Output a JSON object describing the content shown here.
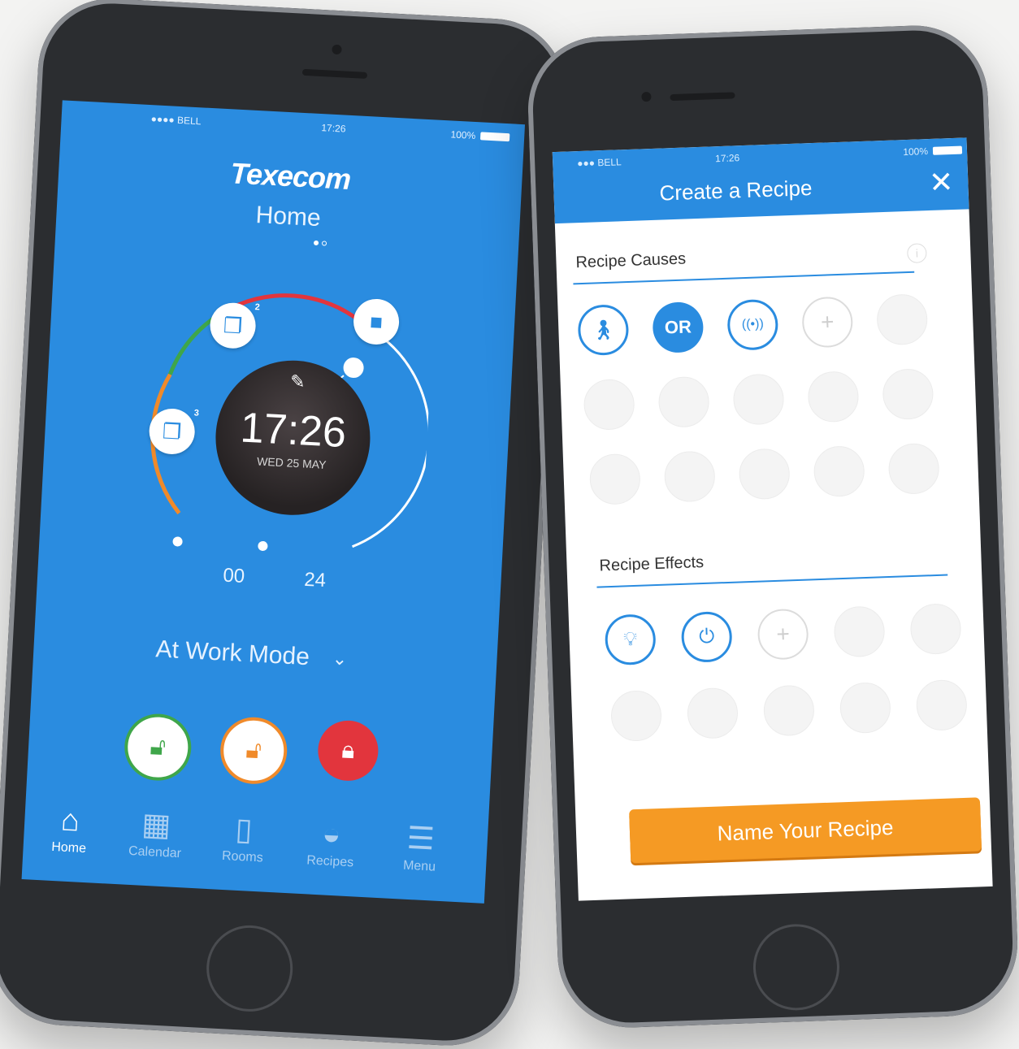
{
  "left_phone": {
    "status": {
      "carrier": "●●●● BELL",
      "time": "17:26",
      "battery": "100%"
    },
    "brand": "Texecom",
    "page_title": "Home",
    "clock": {
      "time": "17:26",
      "date": "WED 25 MAY"
    },
    "timeline": {
      "start_label": "00",
      "end_label": "24"
    },
    "event_badges": {
      "top": "2",
      "left": "3"
    },
    "mode": {
      "label": "At Work Mode"
    },
    "tabs": [
      {
        "label": "Home",
        "icon": "home-icon"
      },
      {
        "label": "Calendar",
        "icon": "calendar-icon"
      },
      {
        "label": "Rooms",
        "icon": "door-icon"
      },
      {
        "label": "Recipes",
        "icon": "mortar-pestle-icon"
      },
      {
        "label": "Menu",
        "icon": "hamburger-menu-icon"
      }
    ],
    "colors": {
      "primary": "#2a8ce0",
      "green": "#3fa64a",
      "orange": "#f08a2a",
      "red": "#e2353d"
    }
  },
  "right_phone": {
    "status": {
      "carrier": "●●● BELL",
      "time": "17:26",
      "battery": "100%"
    },
    "title": "Create a Recipe",
    "causes_label": "Recipe Causes",
    "causes": {
      "or_label": "OR"
    },
    "effects_label": "Recipe Effects",
    "name_button": "Name Your Recipe",
    "colors": {
      "primary": "#2a8ce0",
      "cta": "#f59a24"
    }
  }
}
